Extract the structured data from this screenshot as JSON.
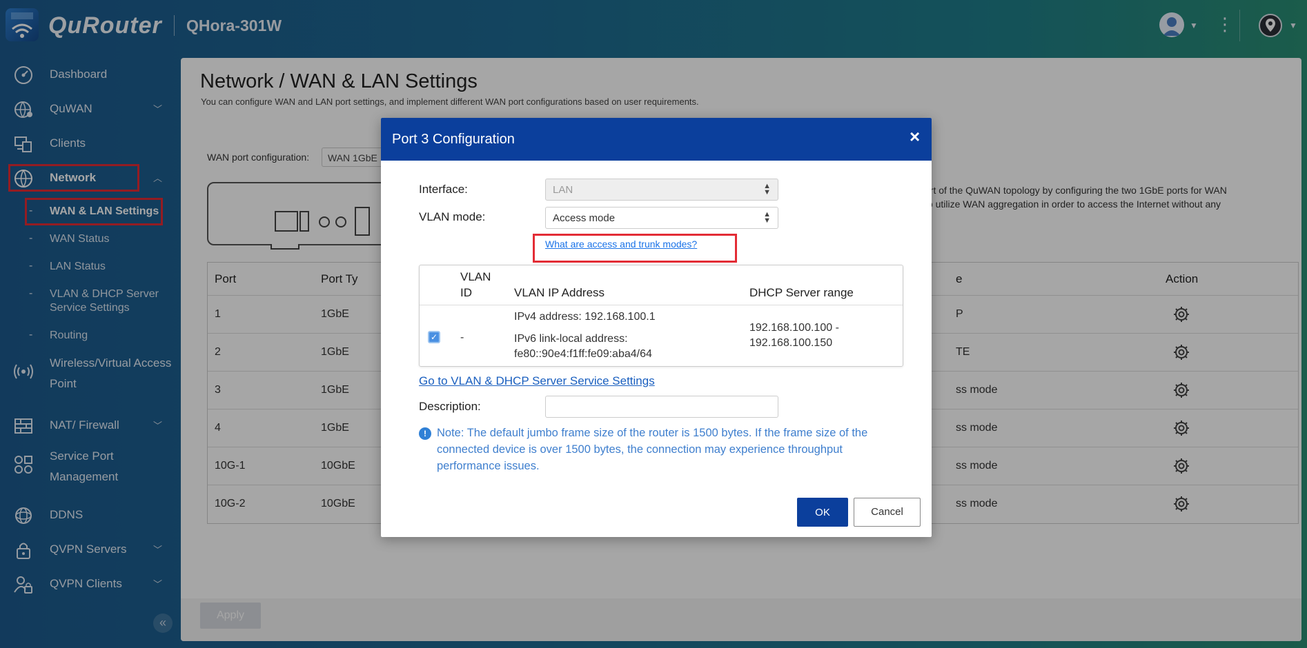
{
  "topbar": {
    "brand": "QuRouter",
    "device_name": "QHora-301W",
    "icons": [
      "router-logo-icon",
      "user-avatar-icon",
      "kebab-menu-icon",
      "location-pin-icon"
    ]
  },
  "sidebar": {
    "items": [
      {
        "label": "Dashboard",
        "icon": "dashboard-icon"
      },
      {
        "label": "QuWAN",
        "icon": "quwan-icon"
      },
      {
        "label": "Clients",
        "icon": "clients-icon"
      },
      {
        "label": "Network",
        "icon": "globe-icon"
      },
      {
        "label": "Wireless/Virtual Access",
        "label2": "Point",
        "icon": "wireless-icon"
      },
      {
        "label": "NAT/ Firewall",
        "icon": "firewall-icon"
      },
      {
        "label": "Service Port",
        "label2": "Management",
        "icon": "service-port-icon"
      },
      {
        "label": "DDNS",
        "icon": "ddns-icon"
      },
      {
        "label": "QVPN Servers",
        "icon": "vpn-server-icon"
      },
      {
        "label": "QVPN Clients",
        "icon": "vpn-client-icon"
      }
    ],
    "network_sub": [
      {
        "label": "WAN & LAN Settings"
      },
      {
        "label": "WAN Status"
      },
      {
        "label": "LAN Status"
      },
      {
        "label": "VLAN & DHCP Server",
        "label2": "Service Settings"
      },
      {
        "label": "Routing"
      }
    ],
    "collapse": "«"
  },
  "main": {
    "title": "Network / WAN & LAN Settings",
    "description": "You can configure WAN and LAN port settings, and implement different WAN port configurations based on user requirements.",
    "wan_port_label": "WAN port configuration:",
    "wan_port_value": "WAN 1GbE",
    "info_line1": "art of the QuWAN topology by configuring the two 1GbE ports for WAN",
    "info_line2": "to utilize WAN aggregation in order to access the Internet without any",
    "table": {
      "headers": [
        "Port",
        "Port Ty",
        "e",
        "Action"
      ],
      "rows": [
        {
          "port": "1",
          "type": "1GbE",
          "mode": "P"
        },
        {
          "port": "2",
          "type": "1GbE",
          "mode": "TE"
        },
        {
          "port": "3",
          "type": "1GbE",
          "mode": "ss mode"
        },
        {
          "port": "4",
          "type": "1GbE",
          "mode": "ss mode"
        },
        {
          "port": "10G-1",
          "type": "10GbE",
          "mode": "ss mode"
        },
        {
          "port": "10G-2",
          "type": "10GbE",
          "mode": "ss mode"
        }
      ]
    },
    "apply": "Apply"
  },
  "dialog": {
    "title": "Port 3 Configuration",
    "close": "×",
    "interface_label": "Interface:",
    "interface_value": "LAN",
    "vlan_mode_label": "VLAN mode:",
    "vlan_mode_value": "Access mode",
    "help_link": "What are access and trunk modes?",
    "vlan_table": {
      "h_vlan_id_1": "VLAN",
      "h_vlan_id_2": "ID",
      "h_ip": "VLAN IP Address",
      "h_dhcp": "DHCP Server range",
      "row": {
        "checked": true,
        "vlan_id": "-",
        "ipv4": "IPv4 address: 192.168.100.1",
        "ipv6_1": "IPv6 link-local address:",
        "ipv6_2": "fe80::90e4:f1ff:fe09:aba4/64",
        "dhcp_1": "192.168.100.100 -",
        "dhcp_2": "192.168.100.150"
      }
    },
    "goto_link": "Go to VLAN & DHCP Server Service Settings",
    "description_label": "Description:",
    "description_value": "",
    "note": "Note: The default jumbo frame size of the router is 1500 bytes. If the frame size of the connected device is over 1500 bytes, the connection may experience throughput performance issues.",
    "ok": "OK",
    "cancel": "Cancel"
  },
  "colors": {
    "accent": "#0b3f9c",
    "highlight": "#e32c35",
    "link": "#1a73e8"
  }
}
